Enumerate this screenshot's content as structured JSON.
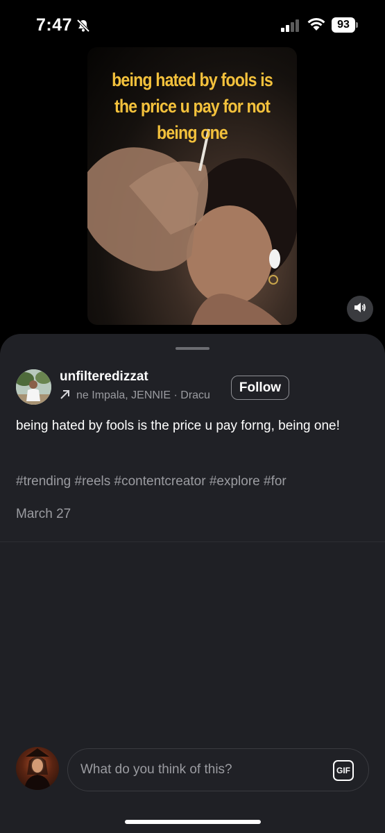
{
  "status_bar": {
    "time": "7:47",
    "battery": "93",
    "icons": [
      "bell-slash-icon",
      "cellular-signal-icon",
      "wifi-icon",
      "battery-icon"
    ]
  },
  "video": {
    "overlay_text": "being hated by fools is the price u pay for not being one",
    "caption_color": "#f3c13c",
    "sound_icon": "speaker-icon"
  },
  "post": {
    "username": "unfilteredizzat",
    "audio_text": "ne Impala, JENNIE · Dracu",
    "audio_icon": "arrow-up-right-icon",
    "follow_label": "Follow",
    "caption": "being hated by fools is the price u pay forng, being one!",
    "hashtags": "#trending #reels #contentcreator #explore #for",
    "date": "March 27"
  },
  "comment_bar": {
    "placeholder": "What do you think of this?",
    "gif_label": "GIF"
  },
  "colors": {
    "background": "#000000",
    "sheet": "#202126",
    "secondary_text": "#9b9ca1"
  }
}
